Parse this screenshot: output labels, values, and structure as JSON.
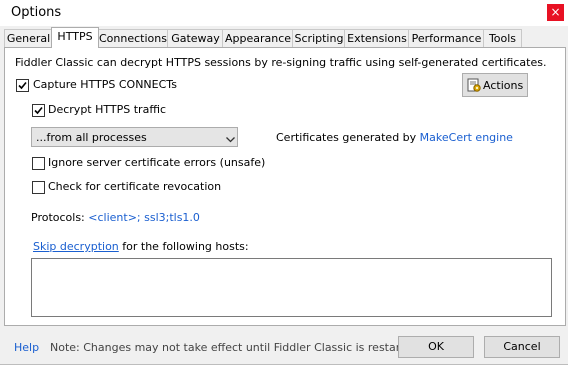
{
  "window": {
    "title": "Options",
    "close_glyph": "×"
  },
  "tabs": [
    {
      "label": "General",
      "active": false
    },
    {
      "label": "HTTPS",
      "active": true
    },
    {
      "label": "Connections",
      "active": false
    },
    {
      "label": "Gateway",
      "active": false
    },
    {
      "label": "Appearance",
      "active": false
    },
    {
      "label": "Scripting",
      "active": false
    },
    {
      "label": "Extensions",
      "active": false
    },
    {
      "label": "Performance",
      "active": false
    },
    {
      "label": "Tools",
      "active": false
    }
  ],
  "https": {
    "intro": "Fiddler Classic can decrypt HTTPS sessions by re-signing traffic using self-generated certificates.",
    "capture_connects": {
      "label": "Capture HTTPS CONNECTs",
      "checked": true
    },
    "actions_button": {
      "label": "Actions",
      "icon": "certificate-icon"
    },
    "decrypt_traffic": {
      "label": "Decrypt HTTPS traffic",
      "checked": true
    },
    "process_filter": {
      "selected": "...from all processes"
    },
    "cert_generator": {
      "prefix": "Certificates generated by ",
      "engine": "MakeCert engine"
    },
    "ignore_errors": {
      "label": "Ignore server certificate errors (unsafe)",
      "checked": false
    },
    "check_revocation": {
      "label": "Check for certificate revocation",
      "checked": false
    },
    "protocols": {
      "label": "Protocols: ",
      "value": "<client>; ssl3;tls1.0"
    },
    "skip_decryption": {
      "link": "Skip decryption",
      "suffix": " for the following hosts:",
      "hosts": ""
    }
  },
  "footer": {
    "help": "Help",
    "note": "Note: Changes may not take effect until Fiddler Classic is restarted.",
    "ok": "OK",
    "cancel": "Cancel"
  },
  "colors": {
    "link": "#1a5fd0",
    "close_button": "#e81123"
  }
}
